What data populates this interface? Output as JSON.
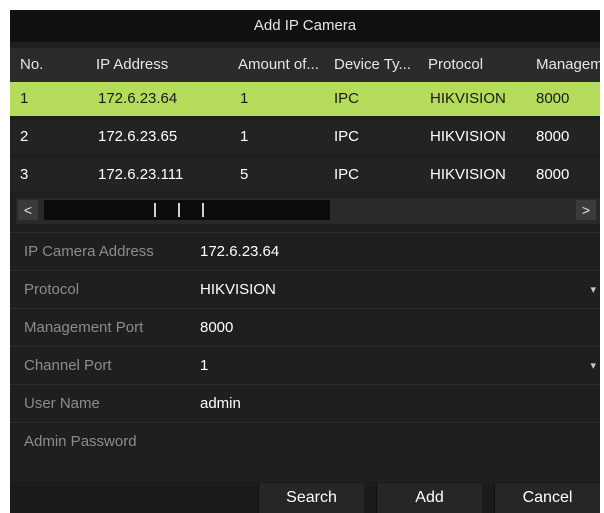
{
  "dialog": {
    "title": "Add IP Camera"
  },
  "table": {
    "columns": [
      "No.",
      "IP Address",
      "Amount of...",
      "Device Ty...",
      "Protocol",
      "Managem"
    ],
    "rows": [
      [
        "1",
        "172.6.23.64",
        "1",
        "IPC",
        "HIKVISION",
        "8000"
      ],
      [
        "2",
        "172.6.23.65",
        "1",
        "IPC",
        "HIKVISION",
        "8000"
      ],
      [
        "3",
        "172.6.23.111",
        "5",
        "IPC",
        "HIKVISION",
        "8000"
      ]
    ],
    "selected_row": 0
  },
  "scrollbar": {
    "left_arrow": "<",
    "right_arrow": ">"
  },
  "form": {
    "ip_camera_address": {
      "label": "IP Camera Address",
      "value": "172.6.23.64"
    },
    "protocol": {
      "label": "Protocol",
      "value": "HIKVISION"
    },
    "management_port": {
      "label": "Management Port",
      "value": "8000"
    },
    "channel_port": {
      "label": "Channel Port",
      "value": "1"
    },
    "user_name": {
      "label": "User Name",
      "value": "admin"
    },
    "admin_password": {
      "label": "Admin Password",
      "value": ""
    }
  },
  "buttons": {
    "search": "Search",
    "add": "Add",
    "cancel": "Cancel"
  },
  "colors": {
    "selected_row": "#b4dc5a",
    "background": "#1f1f1f",
    "header": "#2b2b2b"
  }
}
